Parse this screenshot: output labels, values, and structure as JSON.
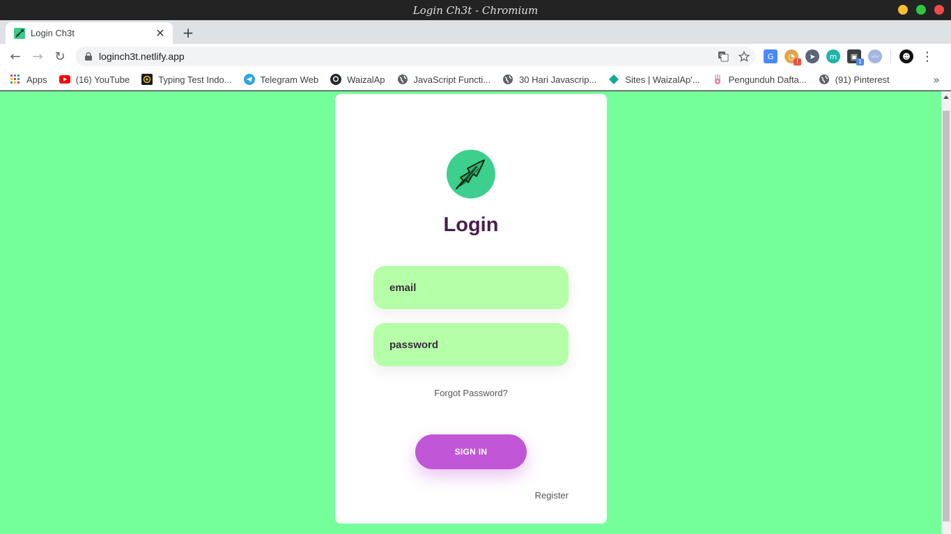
{
  "window": {
    "title": "Login  Ch3t  -  Chromium",
    "controls": [
      {
        "name": "minimize",
        "color": "#f5bf2e"
      },
      {
        "name": "maximize",
        "color": "#2dc840"
      },
      {
        "name": "close",
        "color": "#f24b45"
      }
    ]
  },
  "tab": {
    "title": "Login Ch3t",
    "close_glyph": "✕",
    "new_tab_glyph": "+"
  },
  "toolbar": {
    "back_glyph": "←",
    "forward_glyph": "→",
    "reload_glyph": "↻",
    "url": "loginch3t.netlify.app",
    "menu_glyph": "⋮",
    "extensions": [
      {
        "icon": "translate-ext-icon",
        "color": "#4a8af4",
        "badge": ""
      },
      {
        "icon": "owl-ext-icon",
        "color": "#e0a64c",
        "badge": "!"
      },
      {
        "icon": "cursor-ext-icon",
        "color": "#5a6478",
        "badge": ""
      },
      {
        "icon": "m-ext-icon",
        "color": "#1fb5a8",
        "badge": ""
      },
      {
        "icon": "cube-ext-icon",
        "color": "#3c4043",
        "badge": "1"
      },
      {
        "icon": "wave-ext-icon",
        "color": "#a0b8e0",
        "badge": ""
      },
      {
        "icon": "profile-avatar-icon",
        "color": "#111111",
        "badge": ""
      }
    ]
  },
  "bookmarks": {
    "items": [
      {
        "label": "Apps",
        "icon": "apps-grid-icon"
      },
      {
        "label": "(16) YouTube",
        "icon": "youtube-icon"
      },
      {
        "label": "Typing Test Indo...",
        "icon": "typing-test-icon"
      },
      {
        "label": "Telegram Web",
        "icon": "telegram-icon"
      },
      {
        "label": "WaizalAp",
        "icon": "github-icon"
      },
      {
        "label": "JavaScript Functi...",
        "icon": "globe-icon"
      },
      {
        "label": "30 Hari Javascrip...",
        "icon": "globe-icon"
      },
      {
        "label": "Sites | WaizalAp'...",
        "icon": "sites-icon"
      },
      {
        "label": "Pengunduh Dafta...",
        "icon": "hand-icon"
      },
      {
        "label": "(91) Pinterest",
        "icon": "globe-icon"
      }
    ],
    "more_glyph": "»"
  },
  "page": {
    "background": "#75ff9b",
    "heading": "Login",
    "email_placeholder": "email",
    "password_placeholder": "password",
    "forgot_link": "Forgot Password?",
    "signin_button": "SIGN IN",
    "register_link": "Register",
    "accent": "#c056d6",
    "field_bg": "#b5ffa8"
  }
}
